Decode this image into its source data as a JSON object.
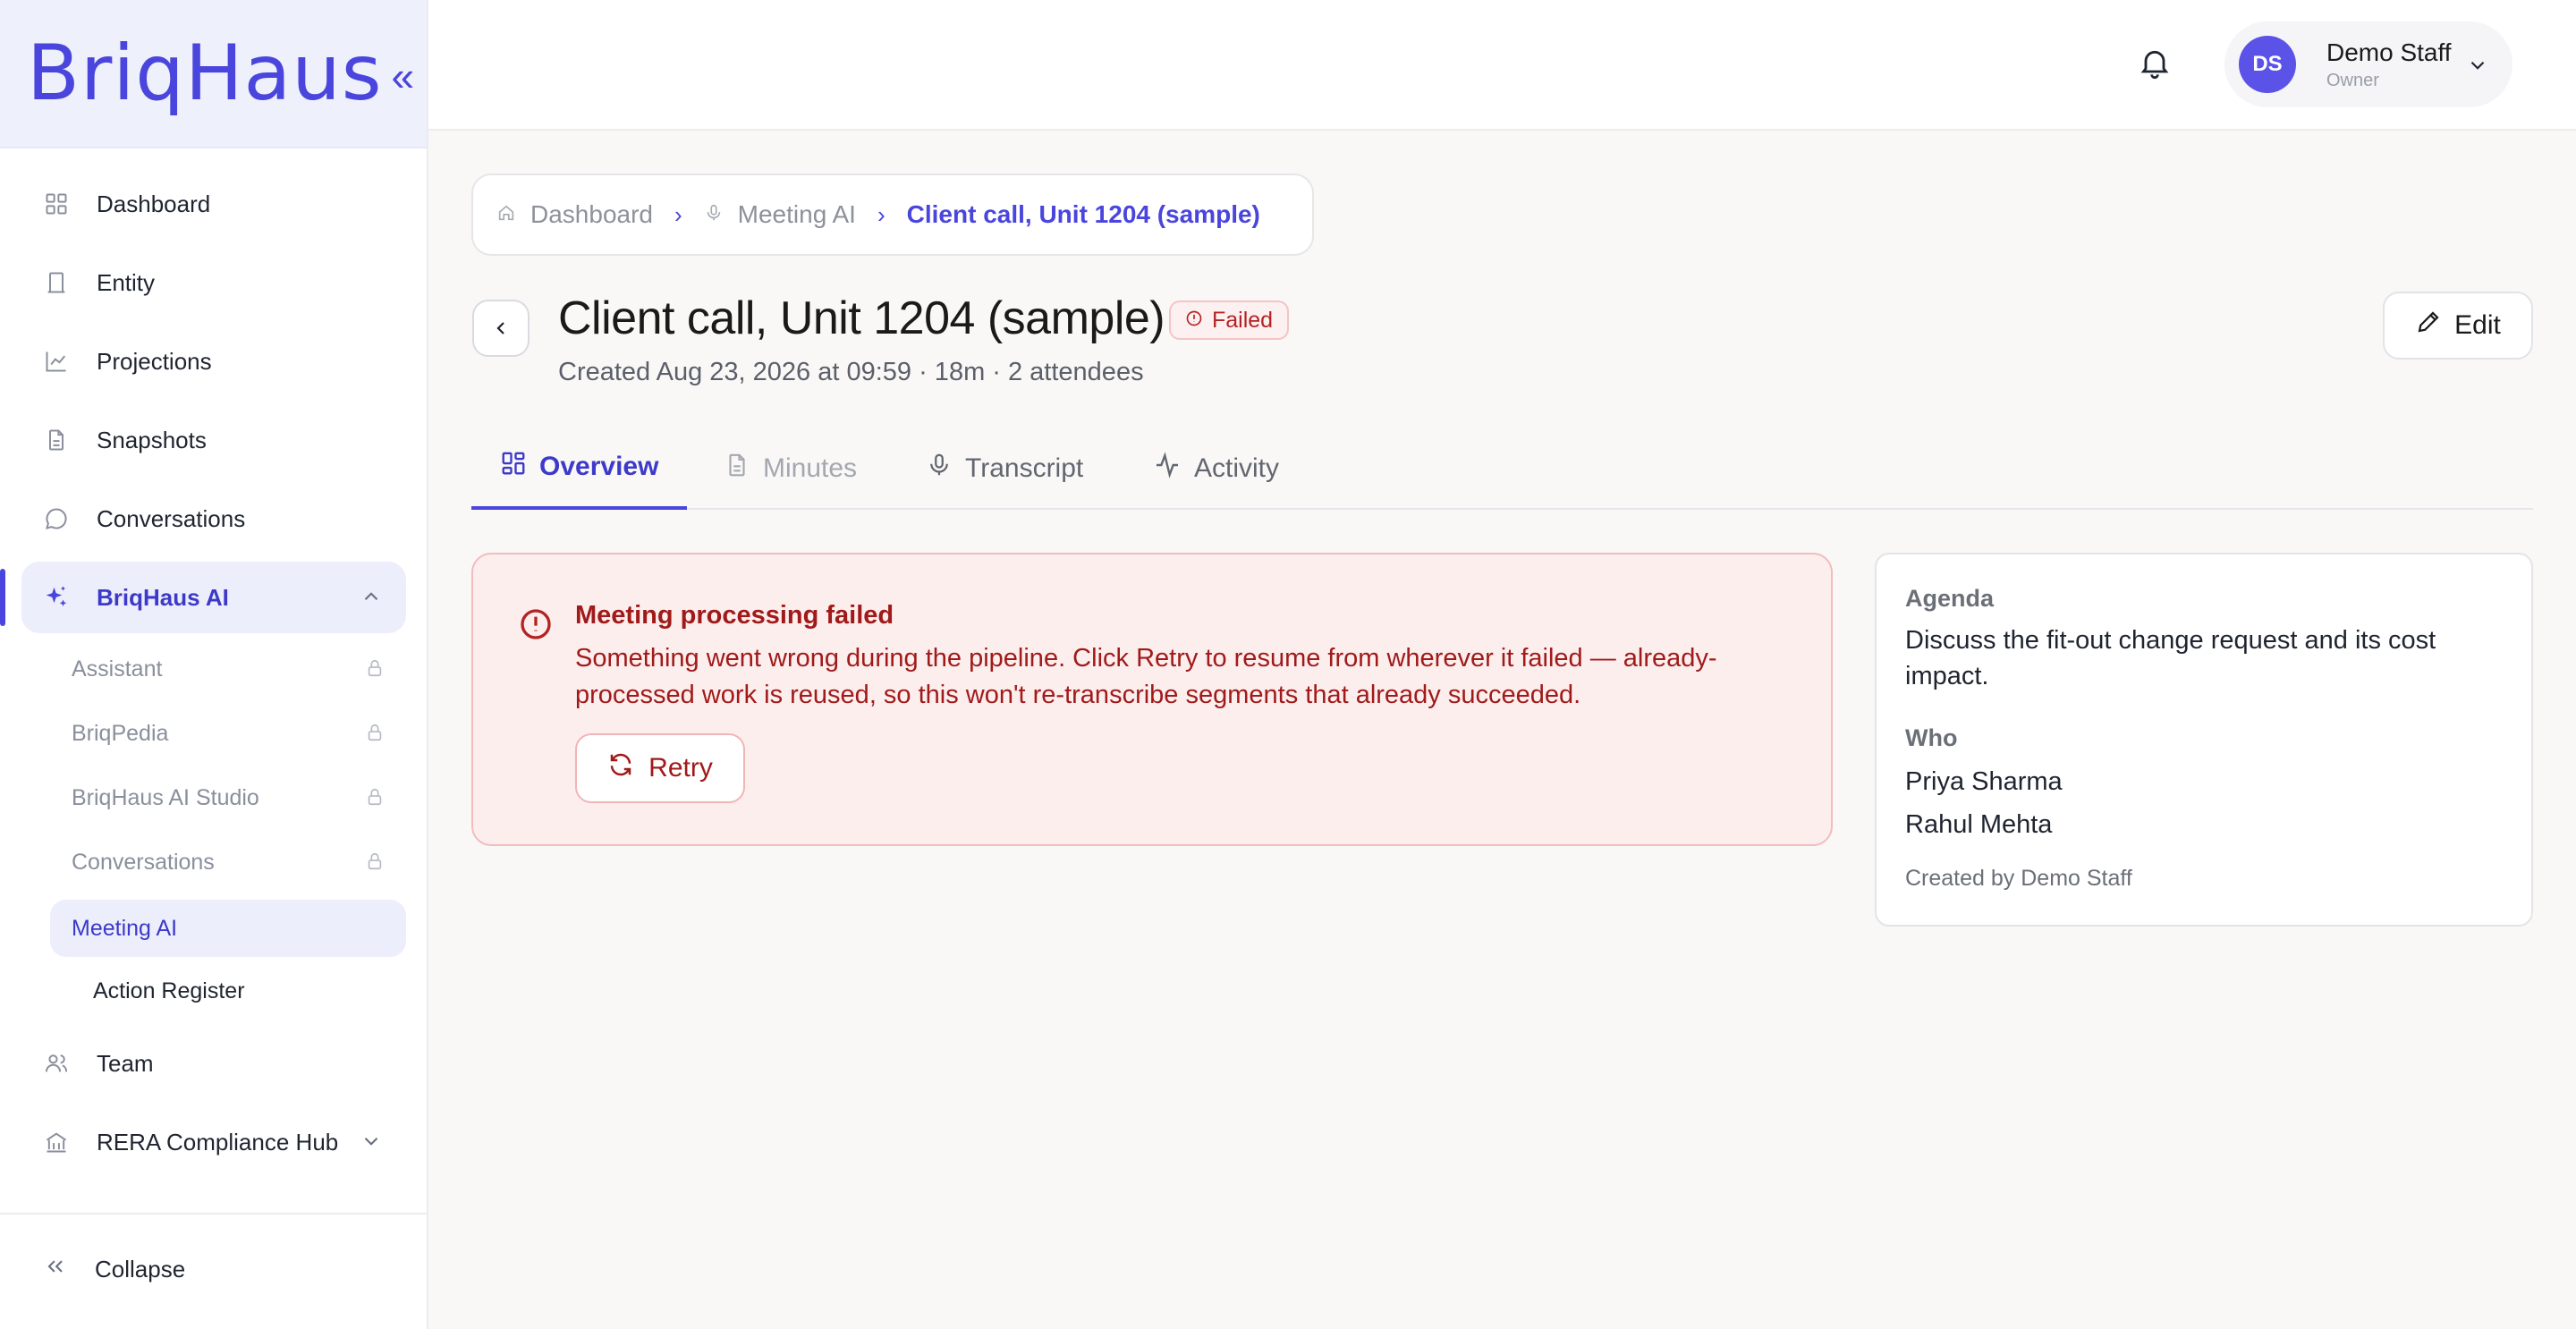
{
  "brand": {
    "logo_text": "BriqHaus",
    "collapse_glyph": "«"
  },
  "sidebar": {
    "items": [
      {
        "label": "Dashboard",
        "icon": "grid-icon"
      },
      {
        "label": "Entity",
        "icon": "building-icon"
      },
      {
        "label": "Projections",
        "icon": "chart-line-icon"
      },
      {
        "label": "Snapshots",
        "icon": "document-icon"
      },
      {
        "label": "Conversations",
        "icon": "chat-bubble-icon"
      },
      {
        "label": "BriqHaus AI",
        "icon": "sparkles-icon"
      }
    ],
    "ai_submenu": [
      {
        "label": "Assistant",
        "locked": true
      },
      {
        "label": "BriqPedia",
        "locked": true
      },
      {
        "label": "BriqHaus AI Studio",
        "locked": true
      },
      {
        "label": "Conversations",
        "locked": true
      },
      {
        "label": "Meeting AI",
        "locked": false
      },
      {
        "label": "Action Register",
        "locked": false
      }
    ],
    "lower_items": [
      {
        "label": "Team",
        "icon": "users-icon"
      },
      {
        "label": "RERA Compliance Hub",
        "icon": "bank-icon"
      }
    ],
    "collapse_label": "Collapse"
  },
  "header": {
    "user": {
      "initials": "DS",
      "name": "Demo Staff",
      "role": "Owner"
    }
  },
  "breadcrumb": {
    "items": [
      "Dashboard",
      "Meeting AI"
    ],
    "current": "Client call, Unit 1204 (sample)"
  },
  "meeting": {
    "title": "Client call, Unit 1204 (sample)",
    "status": "Failed",
    "meta": "Created Aug 23, 2026 at 09:59 · 18m · 2 attendees",
    "edit_label": "Edit"
  },
  "tabs": [
    {
      "label": "Overview",
      "icon": "layout-icon"
    },
    {
      "label": "Minutes",
      "icon": "document-icon"
    },
    {
      "label": "Transcript",
      "icon": "microphone-icon"
    },
    {
      "label": "Activity",
      "icon": "activity-icon"
    }
  ],
  "error": {
    "title": "Meeting processing failed",
    "message": "Something went wrong during the pipeline. Click Retry to resume from wherever it failed — already-processed work is reused, so this won't re-transcribe segments that already succeeded.",
    "retry_label": "Retry"
  },
  "info": {
    "agenda_label": "Agenda",
    "agenda_text": "Discuss the fit-out change request and its cost impact.",
    "who_label": "Who",
    "attendees": [
      "Priya Sharma",
      "Rahul Mehta"
    ],
    "created_by": "Created by Demo Staff"
  },
  "colors": {
    "accent": "#4a45dc",
    "error_text": "#a11a1a",
    "error_bg": "#fdeeee"
  }
}
